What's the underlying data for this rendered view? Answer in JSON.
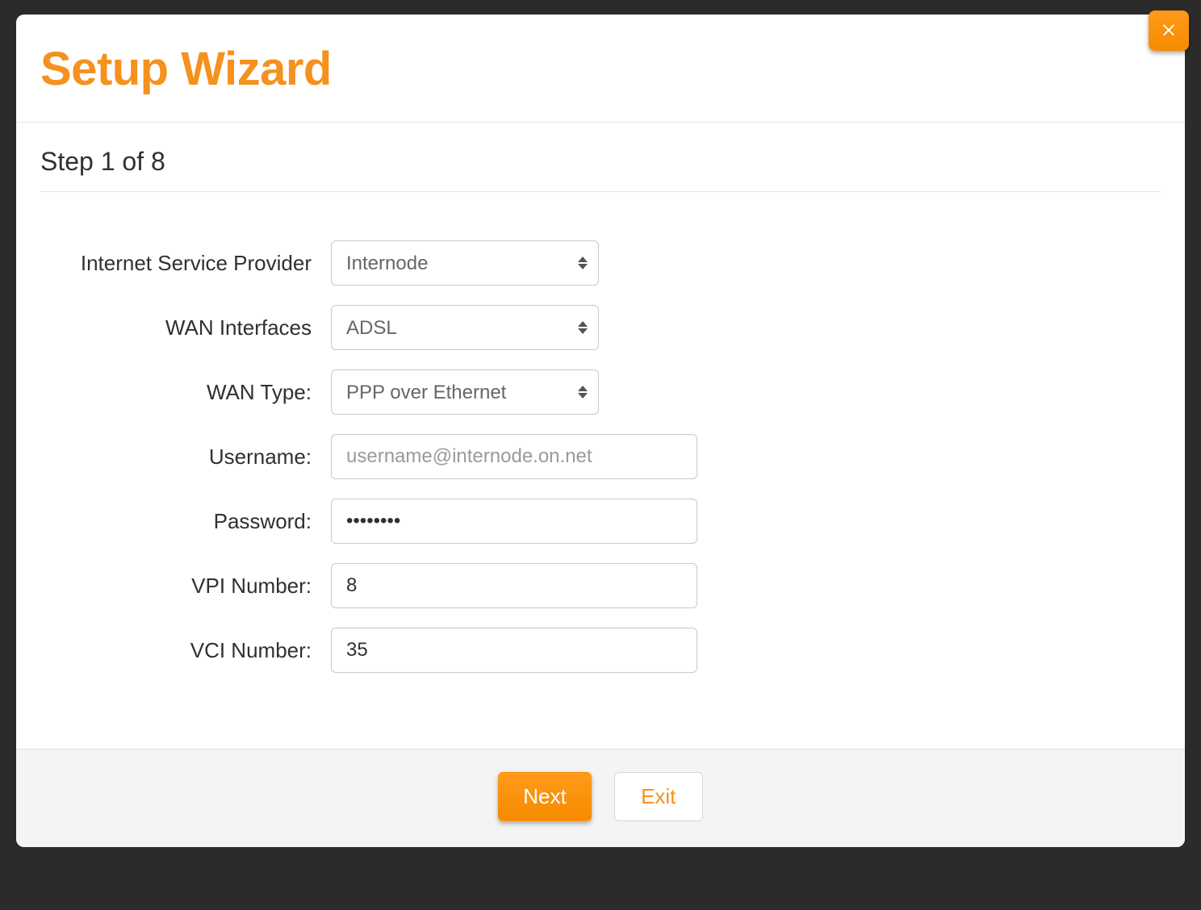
{
  "modal": {
    "title": "Setup Wizard",
    "step_label": "Step 1 of 8"
  },
  "form": {
    "isp": {
      "label": "Internet Service Provider",
      "value": "Internode"
    },
    "wan_if": {
      "label": "WAN Interfaces",
      "value": "ADSL"
    },
    "wan_type": {
      "label": "WAN Type:",
      "value": "PPP over Ethernet"
    },
    "username": {
      "label": "Username:",
      "placeholder": "username@internode.on.net",
      "value": ""
    },
    "password": {
      "label": "Password:",
      "value": "••••••••"
    },
    "vpi": {
      "label": "VPI Number:",
      "value": "8"
    },
    "vci": {
      "label": "VCI Number:",
      "value": "35"
    }
  },
  "buttons": {
    "next": "Next",
    "exit": "Exit"
  }
}
